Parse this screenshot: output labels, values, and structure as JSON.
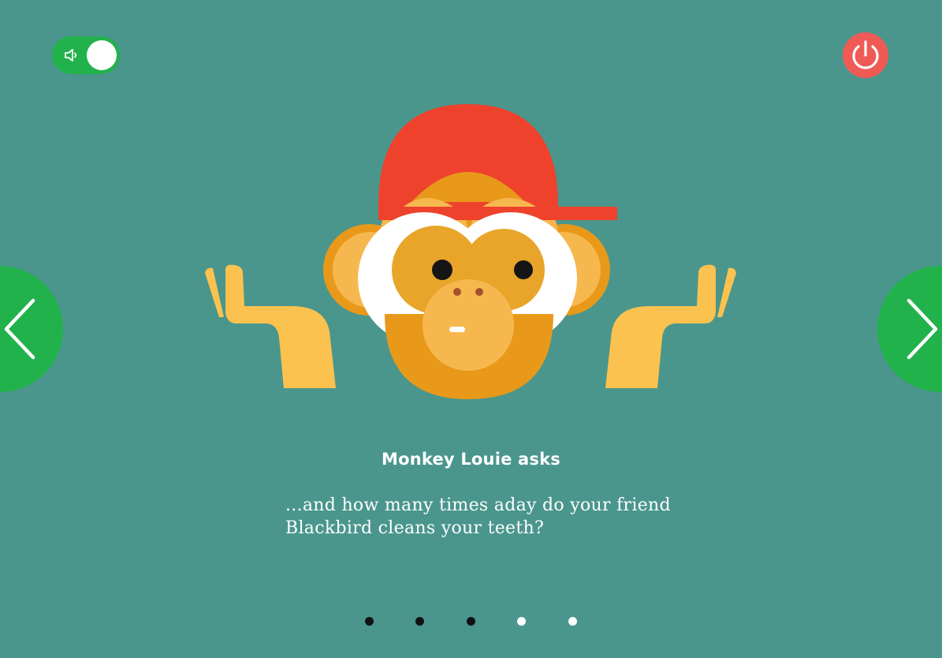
{
  "controls": {
    "sound_toggle_state": "on",
    "power_button_color": "#f05a55",
    "nav_color": "#22b24c"
  },
  "slide": {
    "title": "Monkey Louie asks",
    "text": "...and how many times aday do your friend Blackbird cleans your teeth?"
  },
  "pagination": {
    "total": 5,
    "dots": [
      {
        "state": "dark"
      },
      {
        "state": "dark"
      },
      {
        "state": "dark"
      },
      {
        "state": "light"
      },
      {
        "state": "light"
      }
    ]
  },
  "colors": {
    "background": "#4a968d",
    "cap": "#ee422c",
    "fur_dark": "#e8991a",
    "fur_light": "#f6b84e",
    "hand": "#fbc24f"
  },
  "icons": [
    "speaker-icon",
    "power-icon",
    "chevron-left-icon",
    "chevron-right-icon"
  ]
}
